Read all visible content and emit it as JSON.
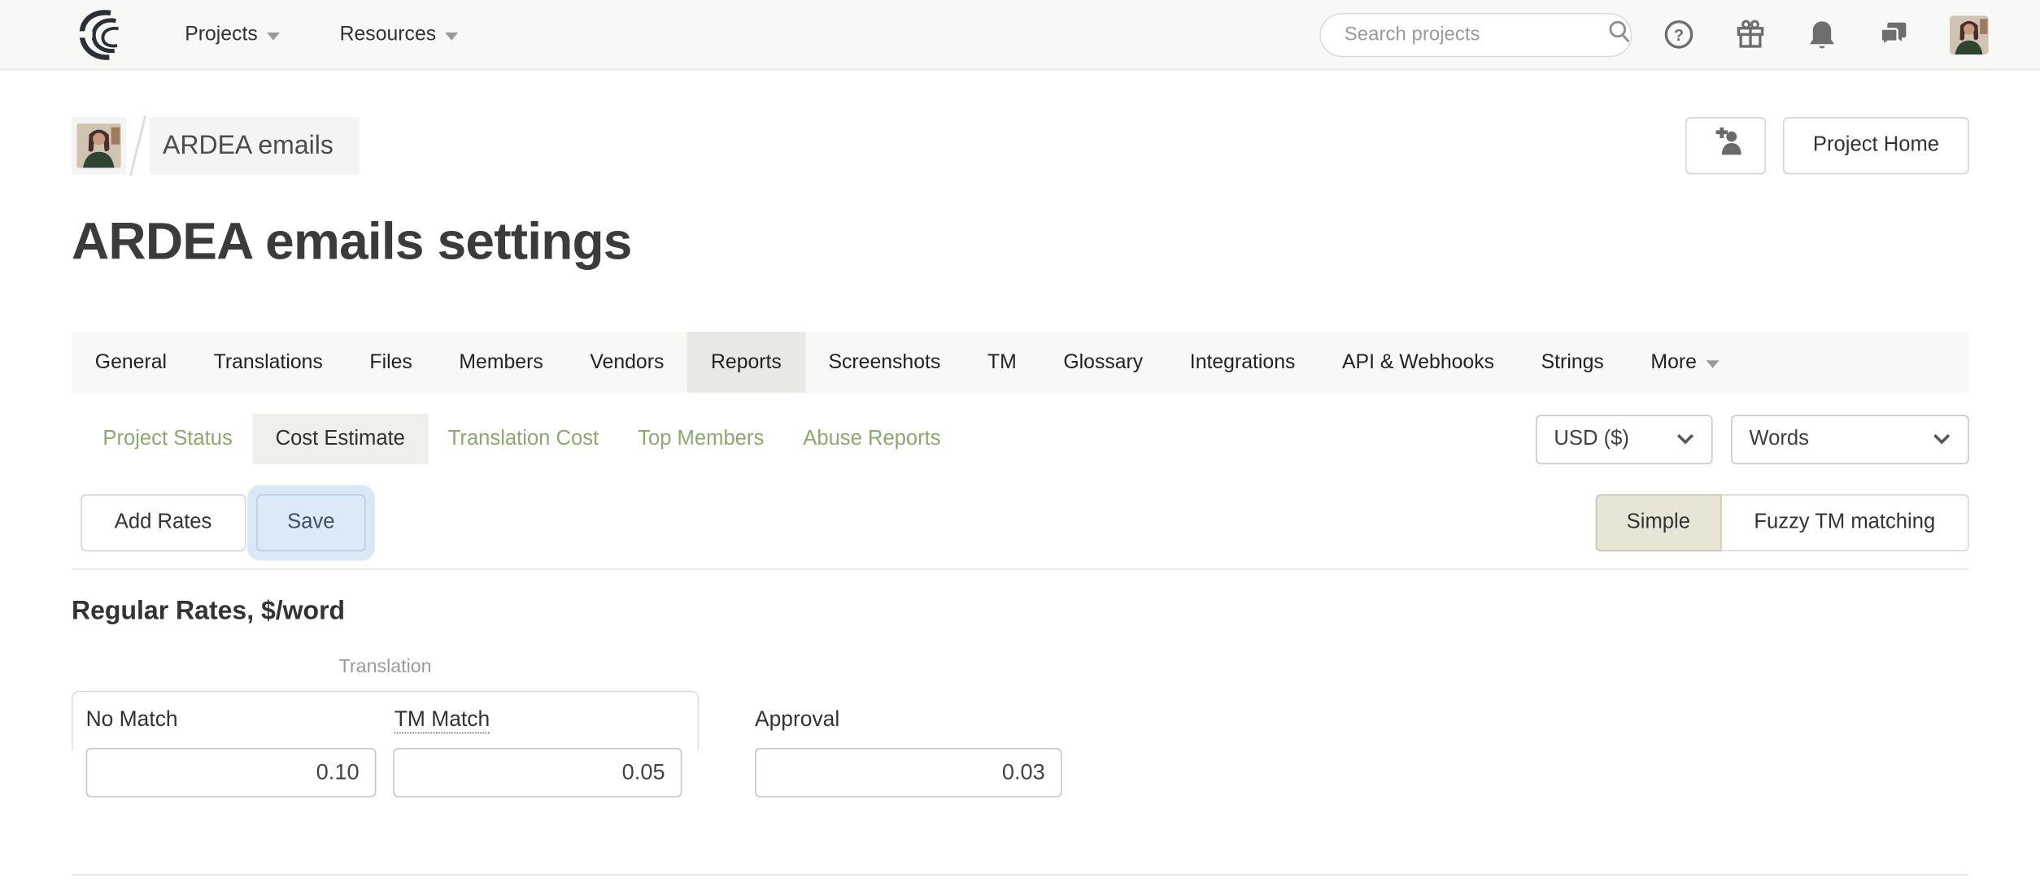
{
  "nav": {
    "projects_label": "Projects",
    "resources_label": "Resources",
    "search_placeholder": "Search projects"
  },
  "breadcrumb": {
    "project_name": "ARDEA emails"
  },
  "header": {
    "title": "ARDEA emails settings",
    "project_home_label": "Project Home"
  },
  "tabs": {
    "items": [
      "General",
      "Translations",
      "Files",
      "Members",
      "Vendors",
      "Reports",
      "Screenshots",
      "TM",
      "Glossary",
      "Integrations",
      "API & Webhooks",
      "Strings",
      "More"
    ],
    "active": "Reports"
  },
  "subtabs": {
    "items": [
      "Project Status",
      "Cost Estimate",
      "Translation Cost",
      "Top Members",
      "Abuse Reports"
    ],
    "active": "Cost Estimate"
  },
  "filters": {
    "currency": "USD ($)",
    "unit": "Words"
  },
  "toolbar": {
    "add_rates_label": "Add Rates",
    "save_label": "Save"
  },
  "mode_toggle": {
    "simple_label": "Simple",
    "fuzzy_label": "Fuzzy TM matching",
    "active": "Simple"
  },
  "rates": {
    "section_title": "Regular Rates, $/word",
    "group_label": "Translation",
    "fields": [
      {
        "label": "No Match",
        "value": "0.10"
      },
      {
        "label": "TM Match",
        "value": "0.05"
      },
      {
        "label": "Approval",
        "value": "0.03"
      }
    ]
  },
  "icons": {
    "logo": "crowdin-swirl",
    "search": "magnifier",
    "help": "question-circle",
    "gifts": "gift",
    "notifications": "bell",
    "messages": "chat-bubbles",
    "invite": "add-person",
    "dropdowns": "chevron-down"
  },
  "colors": {
    "accent_green": "#8aa96c",
    "active_tab_bg": "#e9e8e5",
    "save_focus_halo": "#d9e8f6",
    "simple_active_bg": "#e8e4d6",
    "navbar_bg": "#f8f8f7"
  }
}
